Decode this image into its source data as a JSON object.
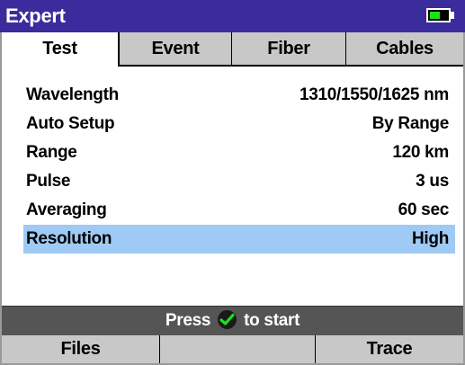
{
  "window": {
    "title": "Expert",
    "battery_level": 0.6
  },
  "tabs": [
    {
      "label": "Test",
      "active": true
    },
    {
      "label": "Event",
      "active": false
    },
    {
      "label": "Fiber",
      "active": false
    },
    {
      "label": "Cables",
      "active": false
    }
  ],
  "settings": [
    {
      "label": "Wavelength",
      "value": "1310/1550/1625 nm"
    },
    {
      "label": "Auto Setup",
      "value": "By Range"
    },
    {
      "label": "Range",
      "value": "120 km"
    },
    {
      "label": "Pulse",
      "value": "3 us"
    },
    {
      "label": "Averaging",
      "value": "60 sec"
    },
    {
      "label": "Resolution",
      "value": "High",
      "selected": true
    }
  ],
  "status": {
    "prefix": "Press",
    "icon": "check-circle-icon",
    "suffix": "to start"
  },
  "softkeys": [
    "Files",
    "",
    "Trace"
  ],
  "colors": {
    "title_bar": "#3a2c9c",
    "selection": "#9ecaf5",
    "status_bar": "#555555",
    "softkey_bar": "#c8c8c8",
    "battery_fill": "#1be21b",
    "check": "#1be21b"
  }
}
